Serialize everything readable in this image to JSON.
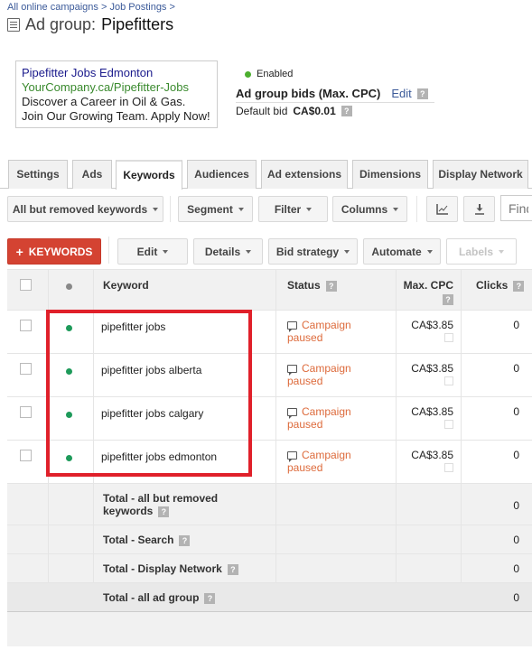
{
  "breadcrumb": {
    "items": [
      "All online campaigns",
      "Job Postings"
    ],
    "separator": ">"
  },
  "page": {
    "title_prefix": "Ad group:",
    "title_name": "Pipefitters"
  },
  "ad_preview": {
    "headline": "Pipefitter Jobs Edmonton",
    "display_url": "YourCompany.ca/Pipefitter-Jobs",
    "description1": "Discover a Career in Oil & Gas.",
    "description2": "Join Our Growing Team. Apply Now!"
  },
  "ad_group_info": {
    "status": "Enabled",
    "status_color": "#4caf2e",
    "bids_title": "Ad group bids (Max. CPC)",
    "edit_label": "Edit",
    "default_bid_label": "Default bid",
    "default_bid_value": "CA$0.01",
    "help_glyph": "?"
  },
  "tabs": [
    {
      "label": "Settings",
      "active": false
    },
    {
      "label": "Ads",
      "active": false
    },
    {
      "label": "Keywords",
      "active": true
    },
    {
      "label": "Audiences",
      "active": false
    },
    {
      "label": "Ad extensions",
      "active": false
    },
    {
      "label": "Dimensions",
      "active": false
    },
    {
      "label": "Display Network",
      "active": false
    }
  ],
  "toolbar": {
    "filter_view": "All but removed keywords",
    "segment": "Segment",
    "filter": "Filter",
    "columns": "Columns",
    "chart_icon": "line-chart-icon",
    "download_icon": "download-icon",
    "find_placeholder": "Find"
  },
  "actions": {
    "add_keywords": "KEYWORDS",
    "add_glyph": "+",
    "edit": "Edit",
    "details": "Details",
    "bid_strategy": "Bid strategy",
    "automate": "Automate",
    "labels": "Labels"
  },
  "table": {
    "headers": {
      "keyword": "Keyword",
      "status": "Status",
      "max_cpc": "Max. CPC",
      "clicks": "Clicks"
    },
    "rows": [
      {
        "keyword": "pipefitter jobs",
        "status": "Campaign paused",
        "status_line1": "Campaign",
        "status_line2": "paused",
        "max_cpc": "CA$3.85",
        "clicks": "0"
      },
      {
        "keyword": "pipefitter jobs alberta",
        "status": "Campaign paused",
        "status_line1": "Campaign",
        "status_line2": "paused",
        "max_cpc": "CA$3.85",
        "clicks": "0"
      },
      {
        "keyword": "pipefitter jobs calgary",
        "status": "Campaign paused",
        "status_line1": "Campaign",
        "status_line2": "paused",
        "max_cpc": "CA$3.85",
        "clicks": "0"
      },
      {
        "keyword": "pipefitter jobs edmonton",
        "status": "Campaign paused",
        "status_line1": "Campaign",
        "status_line2": "paused",
        "max_cpc": "CA$3.85",
        "clicks": "0"
      }
    ],
    "totals": [
      {
        "label_line1": "Total - all but removed",
        "label_line2": "keywords",
        "clicks": "0"
      },
      {
        "label_line1": "Total - Search",
        "label_line2": "",
        "clicks": "0"
      },
      {
        "label_line1": "Total - Display Network",
        "label_line2": "",
        "clicks": "0"
      },
      {
        "label_line1": "Total - all ad group",
        "label_line2": "",
        "clicks": "0"
      }
    ],
    "status_color": "#dd6a3b",
    "enabled_dot_color": "#1e9a5a"
  },
  "annotation": {
    "highlight_color": "#e0202a"
  }
}
